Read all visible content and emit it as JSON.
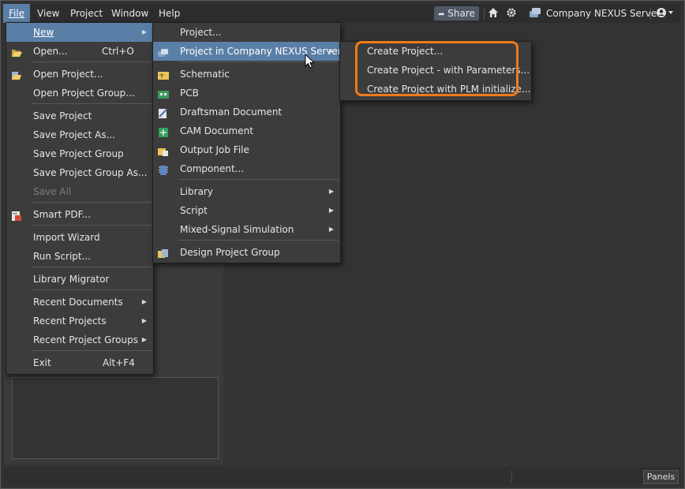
{
  "menubar": {
    "items": [
      "File",
      "View",
      "Project",
      "Window",
      "Help"
    ],
    "share_label": "Share",
    "server_label": "Company NEXUS Server"
  },
  "file_menu": {
    "items": [
      {
        "label": "New",
        "shortcut": "",
        "submenu": true
      },
      {
        "label": "Open...",
        "shortcut": "Ctrl+O"
      },
      {
        "label": "Open Project..."
      },
      {
        "label": "Open Project Group..."
      },
      {
        "label": "Save Project"
      },
      {
        "label": "Save Project As..."
      },
      {
        "label": "Save Project Group"
      },
      {
        "label": "Save Project Group As..."
      },
      {
        "label": "Save All",
        "disabled": true
      },
      {
        "label": "Smart PDF..."
      },
      {
        "label": "Import Wizard"
      },
      {
        "label": "Run Script..."
      },
      {
        "label": "Library Migrator"
      },
      {
        "label": "Recent Documents",
        "submenu": true
      },
      {
        "label": "Recent Projects",
        "submenu": true
      },
      {
        "label": "Recent Project Groups",
        "submenu": true
      },
      {
        "label": "Exit",
        "shortcut": "Alt+F4"
      }
    ]
  },
  "new_menu": {
    "items": [
      {
        "label": "Project..."
      },
      {
        "label": "Project in Company NEXUS Server",
        "submenu": true
      },
      {
        "label": "Schematic"
      },
      {
        "label": "PCB"
      },
      {
        "label": "Draftsman Document"
      },
      {
        "label": "CAM Document"
      },
      {
        "label": "Output Job File"
      },
      {
        "label": "Component..."
      },
      {
        "label": "Library",
        "submenu": true
      },
      {
        "label": "Script",
        "submenu": true
      },
      {
        "label": "Mixed-Signal Simulation",
        "submenu": true
      },
      {
        "label": "Design Project Group"
      }
    ]
  },
  "nexus_menu": {
    "items": [
      {
        "label": "Create Project..."
      },
      {
        "label": "Create Project - with Parameters..."
      },
      {
        "label": "Create Project with PLM initialize..."
      }
    ]
  },
  "status": {
    "panels_label": "Panels"
  },
  "colors": {
    "highlight": "#5a7fa6",
    "callout": "#f07b1a"
  }
}
